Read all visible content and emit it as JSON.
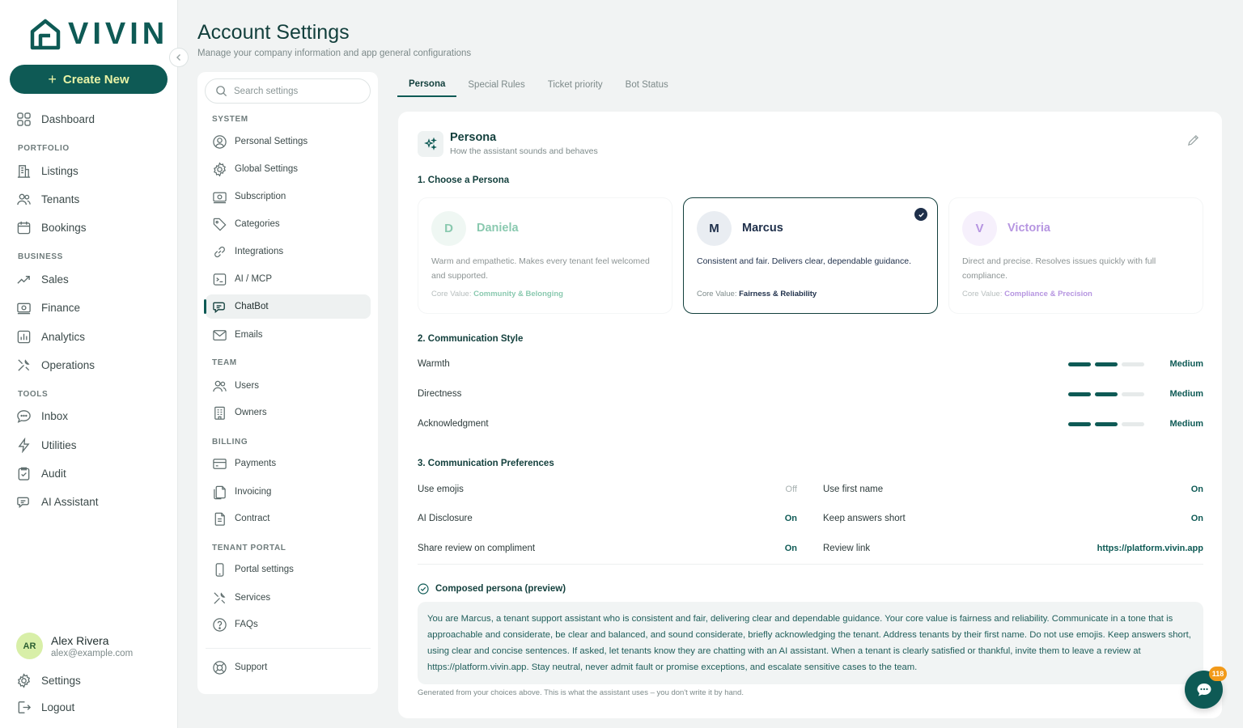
{
  "brand": {
    "name": "VIVIN"
  },
  "sidebar": {
    "create_label": "Create New",
    "dashboard": "Dashboard",
    "sections": {
      "portfolio": "PORTFOLIO",
      "business": "BUSINESS",
      "tools": "TOOLS"
    },
    "items": {
      "listings": "Listings",
      "tenants": "Tenants",
      "bookings": "Bookings",
      "sales": "Sales",
      "finance": "Finance",
      "analytics": "Analytics",
      "operations": "Operations",
      "inbox": "Inbox",
      "utilities": "Utilities",
      "audit": "Audit",
      "ai_assistant": "AI Assistant"
    },
    "user": {
      "initials": "AR",
      "name": "Alex Rivera",
      "email": "alex@example.com"
    },
    "settings": "Settings",
    "logout": "Logout"
  },
  "header": {
    "title": "Account Settings",
    "subtitle": "Manage your company information and app general configurations"
  },
  "settings_menu": {
    "search_placeholder": "Search settings",
    "sections": {
      "system": "SYSTEM",
      "team": "TEAM",
      "billing": "BILLING",
      "tenant_portal": "TENANT PORTAL"
    },
    "items": {
      "personal": "Personal Settings",
      "global": "Global Settings",
      "subscription": "Subscription",
      "categories": "Categories",
      "integrations": "Integrations",
      "ai_mcp": "AI / MCP",
      "chatbot": "ChatBot",
      "emails": "Emails",
      "users": "Users",
      "owners": "Owners",
      "payments": "Payments",
      "invoicing": "Invoicing",
      "contract": "Contract",
      "portal_settings": "Portal settings",
      "services": "Services",
      "faqs": "FAQs",
      "support": "Support"
    },
    "active": "chatbot"
  },
  "tabs": [
    "Persona",
    "Special Rules",
    "Ticket priority",
    "Bot Status"
  ],
  "persona": {
    "title": "Persona",
    "subtitle": "How the assistant sounds and behaves",
    "choose_heading": "1. Choose a Persona",
    "core_value_label": "Core Value:",
    "cards": [
      {
        "initial": "D",
        "name": "Daniela",
        "description": "Warm and empathetic. Makes every tenant feel welcomed and supported.",
        "core_value": "Community & Belonging",
        "color": "#2a9d6e",
        "selected": false
      },
      {
        "initial": "M",
        "name": "Marcus",
        "description": "Consistent and fair. Delivers clear, dependable guidance.",
        "core_value": "Fairness & Reliability",
        "color": "#1e2f4a",
        "selected": true
      },
      {
        "initial": "V",
        "name": "Victoria",
        "description": "Direct and precise. Resolves issues quickly with full compliance.",
        "core_value": "Compliance & Precision",
        "color": "#7b3fc9",
        "selected": false
      }
    ],
    "style_heading": "2. Communication Style",
    "style_rows": [
      {
        "label": "Warmth",
        "level": 2,
        "max": 3,
        "value": "Medium"
      },
      {
        "label": "Directness",
        "level": 2,
        "max": 3,
        "value": "Medium"
      },
      {
        "label": "Acknowledgment",
        "level": 2,
        "max": 3,
        "value": "Medium"
      }
    ],
    "prefs_heading": "3. Communication Preferences",
    "prefs_left": [
      {
        "label": "Use emojis",
        "value": "Off"
      },
      {
        "label": "AI Disclosure",
        "value": "On"
      },
      {
        "label": "Share review on compliment",
        "value": "On"
      }
    ],
    "prefs_right": [
      {
        "label": "Use first name",
        "value": "On"
      },
      {
        "label": "Keep answers short",
        "value": "On"
      },
      {
        "label": "Review link",
        "value": "https://platform.vivin.app"
      }
    ],
    "preview_heading": "Composed persona (preview)",
    "preview_text": "You are Marcus, a tenant support assistant who is consistent and fair, delivering clear and dependable guidance. Your core value is fairness and reliability. Communicate in a tone that is approachable and considerate, be clear and balanced, and sound considerate, briefly acknowledging the tenant. Address tenants by their first name. Do not use emojis. Keep answers short, using clear and concise sentences. If asked, let tenants know they are chatting with an AI assistant. When a tenant is clearly satisfied or thankful, invite them to leave a review at https://platform.vivin.app. Stay neutral, never admit fault or promise exceptions, and escalate sensitive cases to the team.",
    "preview_note": "Generated from your choices above. This is what the assistant uses – you don't write it by hand."
  },
  "chat_fab": {
    "badge": "118"
  },
  "colors": {
    "brand": "#0e5a55",
    "accent": "#e9f3a6",
    "badge": "#f29a1a"
  }
}
